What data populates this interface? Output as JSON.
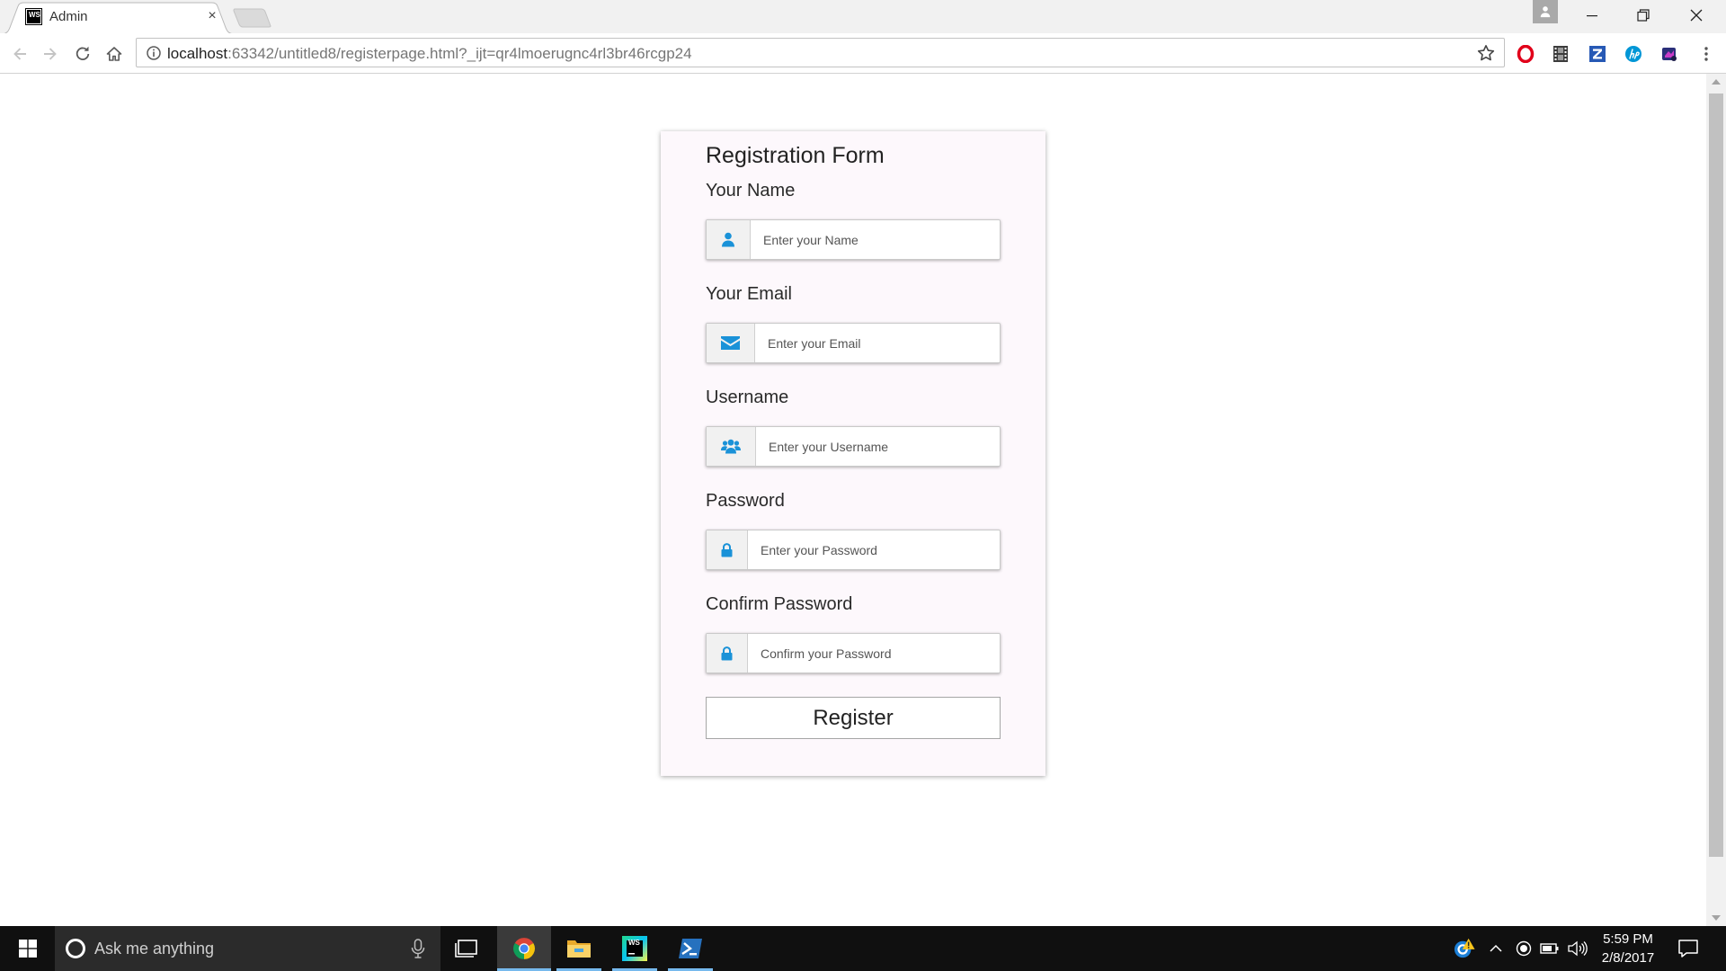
{
  "colors": {
    "accent": "#1a92d8",
    "card_background": "#fdf8fc",
    "taskbar_background": "#101010",
    "taskbar_running_indicator": "#76b9ed"
  },
  "browser": {
    "tab": {
      "favicon_text": "WS",
      "title": "Admin",
      "close_symbol": "×"
    },
    "address_bar": {
      "host": "localhost",
      "path": ":63342/untitled8/registerpage.html?_ijt=qr4lmoerugnc4rl3br46rcgp24"
    },
    "toolbar_icons": [
      "back-icon",
      "forward-icon",
      "reload-icon",
      "home-icon",
      "info-icon",
      "bookmark-star-icon"
    ],
    "extension_icons": [
      "opera-icon",
      "film-icon",
      "z-extension-icon",
      "hp-icon",
      "extension-icon",
      "menu-icon"
    ],
    "window_controls": [
      "profile-icon",
      "minimize-icon",
      "restore-icon",
      "close-icon"
    ]
  },
  "form": {
    "title": "Registration Form",
    "fields": [
      {
        "label": "Your Name",
        "placeholder": "Enter your Name",
        "value": "",
        "icon": "user-icon"
      },
      {
        "label": "Your Email",
        "placeholder": "Enter your Email",
        "value": "",
        "icon": "envelope-icon"
      },
      {
        "label": "Username",
        "placeholder": "Enter your Username",
        "value": "",
        "icon": "users-icon"
      },
      {
        "label": "Password",
        "placeholder": "Enter your Password",
        "value": "",
        "icon": "lock-icon"
      },
      {
        "label": "Confirm Password",
        "placeholder": "Confirm your Password",
        "value": "",
        "icon": "lock-icon"
      }
    ],
    "submit_label": "Register"
  },
  "taskbar": {
    "search_placeholder": "Ask me anything",
    "pinned_apps": [
      "chrome-icon",
      "file-explorer-icon",
      "webstorm-icon",
      "powershell-icon"
    ],
    "active_app": "chrome-icon",
    "tray_icons": [
      "update-warning-icon",
      "show-hidden-icons-icon",
      "record-icon",
      "battery-icon",
      "volume-icon"
    ],
    "clock": {
      "time": "5:59 PM",
      "date": "2/8/2017"
    }
  }
}
